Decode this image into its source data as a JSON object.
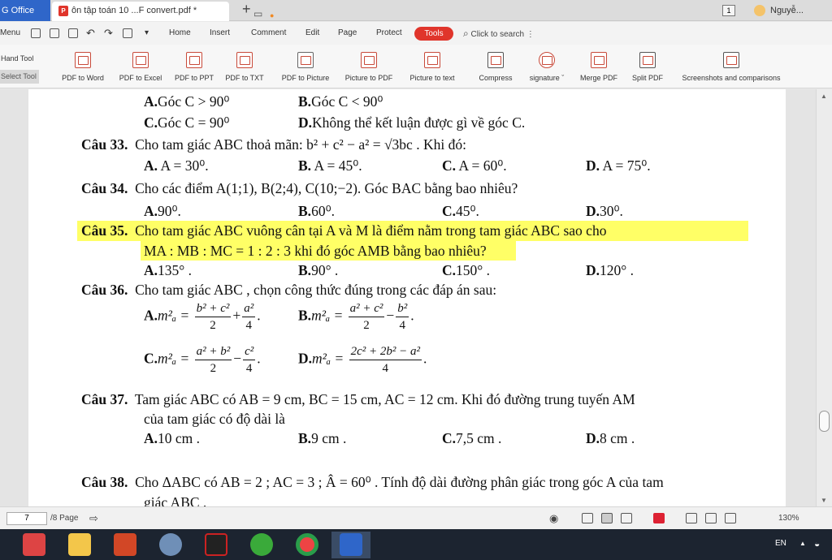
{
  "tabbar": {
    "app_tab": "G Office",
    "doc_tab_title": "ôn tập toán 10 ...F convert.pdf *",
    "doc_tab_dot": "●",
    "new_tab": "+",
    "page_badge": "1",
    "user_name": "Nguyễ...",
    "min": "—",
    "restore": "▭",
    "close": "✕"
  },
  "menu": {
    "menu_label": "Menu",
    "items": [
      "Home",
      "Insert",
      "Comment",
      "Edit",
      "Page",
      "Protect"
    ],
    "tools_label": "Tools",
    "search_placeholder": "Click to search",
    "more": "⋮"
  },
  "ribbon": {
    "hand_tool": "Hand Tool",
    "select_tool": "Select Tool",
    "buttons": [
      {
        "label": "PDF to Word",
        "icon": "pdf-to-word-icon"
      },
      {
        "label": "PDF to Excel",
        "icon": "pdf-to-excel-icon"
      },
      {
        "label": "PDF to PPT",
        "icon": "pdf-to-ppt-icon"
      },
      {
        "label": "PDF to TXT",
        "icon": "pdf-to-txt-icon"
      },
      {
        "label": "PDF to Picture",
        "icon": "pdf-to-picture-icon"
      },
      {
        "label": "Picture to PDF",
        "icon": "picture-to-pdf-icon"
      },
      {
        "label": "Picture to text",
        "icon": "picture-to-text-icon"
      },
      {
        "label": "Compress",
        "icon": "compress-icon"
      },
      {
        "label": "signature ˇ",
        "icon": "signature-icon"
      },
      {
        "label": "Merge PDF",
        "icon": "merge-pdf-icon"
      },
      {
        "label": "Split PDF",
        "icon": "split-pdf-icon"
      },
      {
        "label": "Screenshots and comparisons",
        "icon": "screenshot-icon"
      }
    ]
  },
  "document": {
    "q32": {
      "a_label": "A.",
      "a_text": "Góc C > 90⁰",
      "b_label": "B.",
      "b_text": "Góc C < 90⁰",
      "c_label": "C.",
      "c_text": "Góc C = 90⁰",
      "d_label": "D.",
      "d_text": "Không thể kết luận được gì về góc C."
    },
    "q33": {
      "num": "Câu 33.",
      "stem": "Cho tam giác ABC thoả mãn: b² + c² − a² = √3bc . Khi đó:",
      "a_label": "A.",
      "a_text": "A = 30⁰.",
      "b_label": "B.",
      "b_text": "A = 45⁰.",
      "c_label": "C.",
      "c_text": "A = 60⁰.",
      "d_label": "D.",
      "d_text": "A = 75⁰."
    },
    "q34": {
      "num": "Câu 34.",
      "stem": "Cho các điểm A(1;1), B(2;4), C(10;−2). Góc BAC bằng bao nhiêu?",
      "a_label": "A.",
      "a_text": "90⁰.",
      "b_label": "B.",
      "b_text": "60⁰.",
      "c_label": "C.",
      "c_text": "45⁰.",
      "d_label": "D.",
      "d_text": "30⁰."
    },
    "q35": {
      "num": "Câu 35.",
      "stem1": "Cho tam giác ABC vuông cân tại A và M là điểm nằm trong tam giác ABC sao cho",
      "stem2": "MA : MB : MC = 1 : 2 : 3 khi đó góc AMB bằng bao nhiêu?",
      "a_label": "A.",
      "a_text": "135° .",
      "b_label": "B.",
      "b_text": "90° .",
      "c_label": "C.",
      "c_text": "150° .",
      "d_label": "D.",
      "d_text": "120° ."
    },
    "q36": {
      "num": "Câu 36.",
      "stem": "Cho tam giác ABC , chọn công thức đúng trong các đáp án sau:",
      "a_label": "A.",
      "a_lhs": "m²ₐ =",
      "a_f1_n": "b² + c²",
      "a_f1_d": "2",
      "a_op": "+",
      "a_f2_n": "a²",
      "a_f2_d": "4",
      "a_end": ".",
      "b_label": "B.",
      "b_lhs": "m²ₐ =",
      "b_f1_n": "a² + c²",
      "b_f1_d": "2",
      "b_op": "−",
      "b_f2_n": "b²",
      "b_f2_d": "4",
      "b_end": ".",
      "c_label": "C.",
      "c_lhs": "m²ₐ =",
      "c_f1_n": "a² + b²",
      "c_f1_d": "2",
      "c_op": "−",
      "c_f2_n": "c²",
      "c_f2_d": "4",
      "c_end": ".",
      "d_label": "D.",
      "d_lhs": "m²ₐ =",
      "d_f1_n": "2c² + 2b² − a²",
      "d_f1_d": "4",
      "d_end": "."
    },
    "q37": {
      "num": "Câu 37.",
      "stem1": "Tam giác ABC có AB = 9 cm, BC = 15 cm, AC = 12 cm. Khi đó đường trung tuyến AM",
      "stem2": "của tam giác có độ dài là",
      "a_label": "A.",
      "a_text": "10 cm .",
      "b_label": "B.",
      "b_text": "9 cm .",
      "c_label": "C.",
      "c_text": "7,5 cm .",
      "d_label": "D.",
      "d_text": "8 cm ."
    },
    "q38": {
      "num": "Câu 38.",
      "stem1": "Cho ΔABC có AB = 2 ; AC = 3 ; Â = 60⁰ . Tính độ dài đường phân giác trong góc A của tam",
      "stem2": "giác ABC ."
    }
  },
  "status": {
    "page_input": "7",
    "page_total": "/8 Page",
    "zoom": "130%"
  },
  "taskbar": {
    "lang": "EN",
    "tray_arrow": "▲"
  },
  "colors": {
    "highlight": "#ffff66",
    "accent": "#e0352b",
    "office_blue": "#2f66c9"
  }
}
